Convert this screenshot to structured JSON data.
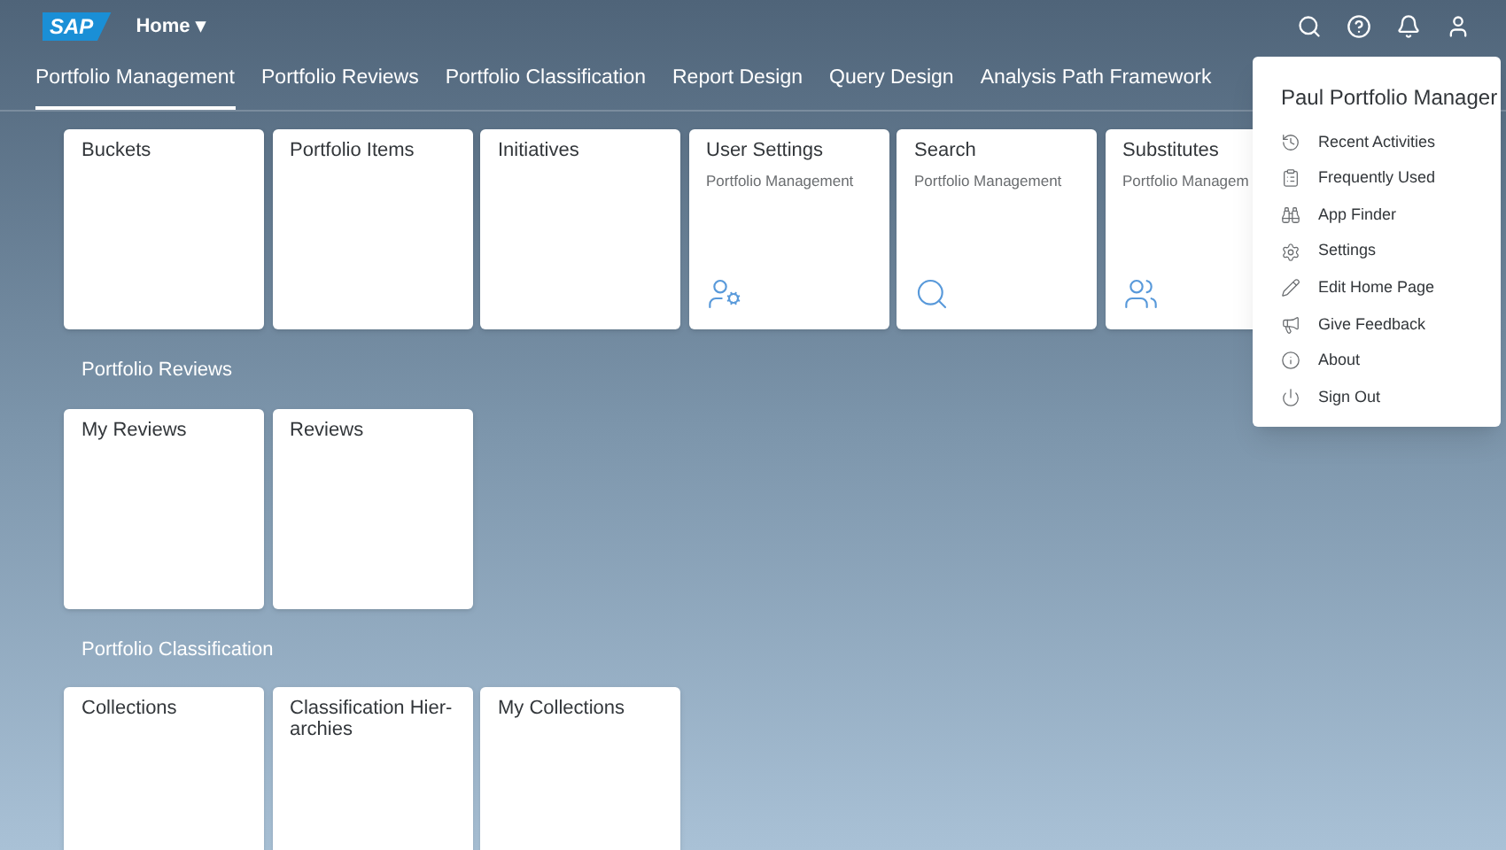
{
  "header": {
    "logo": "SAP",
    "title": "Home",
    "title_caret": "▾"
  },
  "tabs": [
    {
      "label": "Portfolio Management",
      "selected": true
    },
    {
      "label": "Portfolio Reviews",
      "selected": false
    },
    {
      "label": "Portfolio Classification",
      "selected": false
    },
    {
      "label": "Report Design",
      "selected": false
    },
    {
      "label": "Query Design",
      "selected": false
    },
    {
      "label": "Analysis Path Framework",
      "selected": false
    }
  ],
  "groups": [
    {
      "tiles": [
        {
          "title": "Buckets"
        },
        {
          "title": "Portfolio Items"
        },
        {
          "title": "Initiatives"
        },
        {
          "title": "User Settings",
          "subtitle": "Portfolio Management"
        },
        {
          "title": "Search",
          "subtitle": "Portfolio Management"
        },
        {
          "title": "Substitutes",
          "subtitle": "Portfolio Managem"
        }
      ]
    },
    {
      "title": "Portfolio Reviews",
      "tiles": [
        {
          "title": "My Reviews"
        },
        {
          "title": "Reviews"
        }
      ]
    },
    {
      "title": "Portfolio Classification",
      "tiles": [
        {
          "title": "Collections"
        },
        {
          "title": "Classification Hier-archies"
        },
        {
          "title": "My Collections"
        }
      ]
    }
  ],
  "user_menu": {
    "name": "Paul Portfolio Manager",
    "items": [
      {
        "label": "Recent Activities"
      },
      {
        "label": "Frequently Used"
      },
      {
        "label": "App Finder"
      },
      {
        "label": "Settings"
      },
      {
        "label": "Edit Home Page"
      },
      {
        "label": "Give Feedback"
      },
      {
        "label": "About"
      },
      {
        "label": "Sign Out"
      }
    ]
  }
}
